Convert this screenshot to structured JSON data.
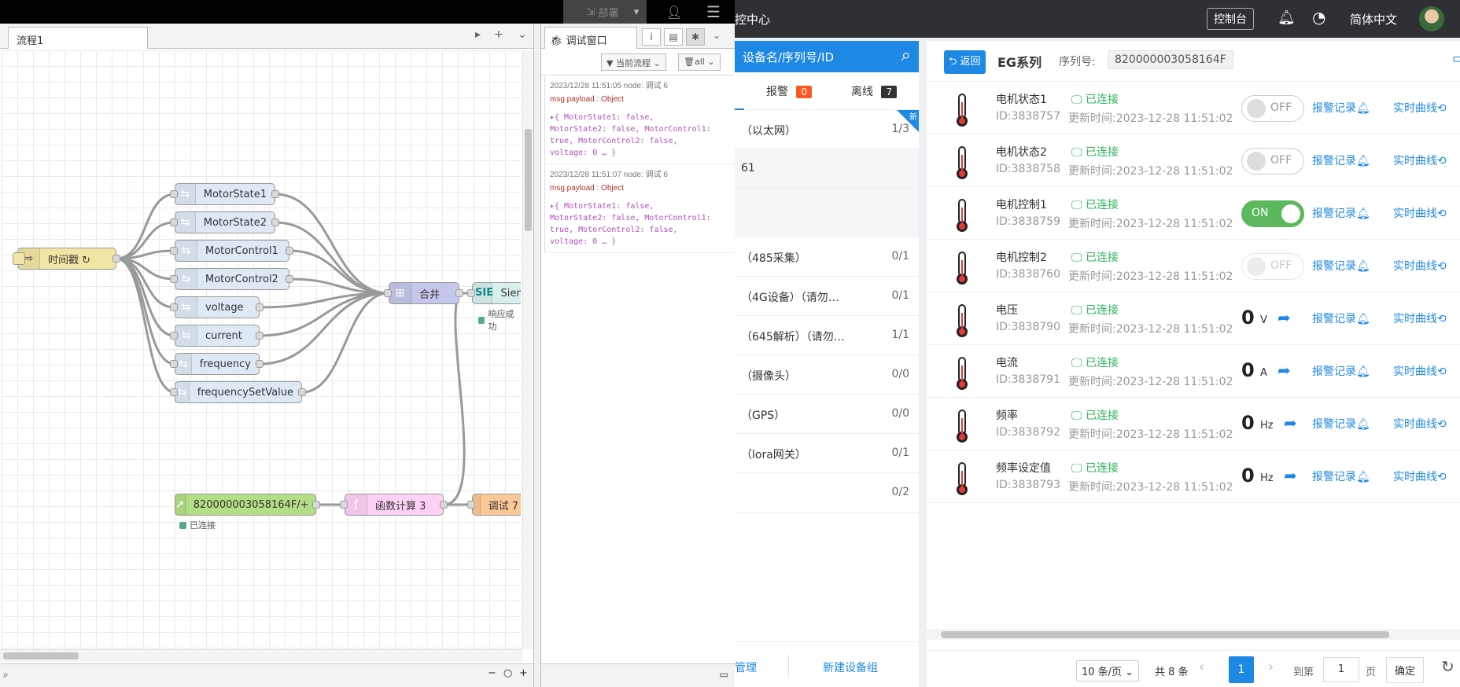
{
  "topbar": {
    "partial_title": "控中心",
    "console": "控制台",
    "language": "简体中文"
  },
  "device_list": {
    "search_placeholder": "设备名/序列号/ID",
    "tabs": [
      {
        "label": "报警",
        "count": "0",
        "color": "#ff5722"
      },
      {
        "label": "离线",
        "count": "7",
        "color": "#333"
      }
    ],
    "new_badge": "新",
    "groups": [
      {
        "name": "（以太网）",
        "count": "1/3"
      },
      {
        "name": "61",
        "count": ""
      },
      {
        "name": "",
        "count": ""
      },
      {
        "name": "（485采集）",
        "count": "0/1"
      },
      {
        "name": "（4G设备）（请勿…",
        "count": "0/1"
      },
      {
        "name": "（645解析）（请勿…",
        "count": "1/1"
      },
      {
        "name": "（摄像头）",
        "count": "0/0"
      },
      {
        "name": "（GPS）",
        "count": "0/0"
      },
      {
        "name": "（lora网关）",
        "count": "0/1"
      },
      {
        "name": "",
        "count": "0/2"
      }
    ],
    "footer_manage": "管理",
    "footer_new_group": "新建设备组"
  },
  "device_detail": {
    "back": "返回",
    "series": "EG系列",
    "serial_label": "序列号:",
    "serial": "820000003058164F",
    "alarm_link": "报警记录",
    "curve_link": "实时曲线",
    "rows": [
      {
        "name": "电机状态1",
        "id": "ID:3838757",
        "status": "已连接",
        "updated": "更新时间:2023-12-28 11:51:02",
        "control": "toggle",
        "state": "OFF"
      },
      {
        "name": "电机状态2",
        "id": "ID:3838758",
        "status": "已连接",
        "updated": "更新时间:2023-12-28 11:51:02",
        "control": "toggle",
        "state": "OFF"
      },
      {
        "name": "电机控制1",
        "id": "ID:3838759",
        "status": "已连接",
        "updated": "更新时间:2023-12-28 11:51:02",
        "control": "toggle",
        "state": "ON"
      },
      {
        "name": "电机控制2",
        "id": "ID:3838760",
        "status": "已连接",
        "updated": "更新时间:2023-12-28 11:51:02",
        "control": "toggle",
        "state": "OFF"
      },
      {
        "name": "电压",
        "id": "ID:3838790",
        "status": "已连接",
        "updated": "更新时间:2023-12-28 11:51:02",
        "control": "value",
        "value": "0",
        "unit": "V"
      },
      {
        "name": "电流",
        "id": "ID:3838791",
        "status": "已连接",
        "updated": "更新时间:2023-12-28 11:51:02",
        "control": "value",
        "value": "0",
        "unit": "A"
      },
      {
        "name": "频率",
        "id": "ID:3838792",
        "status": "已连接",
        "updated": "更新时间:2023-12-28 11:51:02",
        "control": "value",
        "value": "0",
        "unit": "Hz"
      },
      {
        "name": "频率设定值",
        "id": "ID:3838793",
        "status": "已连接",
        "updated": "更新时间:2023-12-28 11:51:02",
        "control": "value",
        "value": "0",
        "unit": "Hz"
      }
    ],
    "pager": {
      "page_size": "10 条/页",
      "total": "共 8 条",
      "current": "1",
      "goto": "到第",
      "goto_value": "1",
      "page_unit": "页",
      "confirm": "确定"
    }
  },
  "nodered": {
    "deploy": "部署",
    "flow_tab": "流程1",
    "debug_tab": "调试窗口",
    "filter_flow": "当前流程",
    "filter_all": "all",
    "messages": [
      {
        "meta": "2023/12/28 11:51:05   node: 调试 6",
        "type": "msg.payload : Object",
        "lines": [
          "▸{ MotorState1: false,",
          "MotorState2: false, MotorControl1:",
          "true, MotorControl2: false,",
          "voltage: 0 … }"
        ]
      },
      {
        "meta": "2023/12/28 11:51:07   node: 调试 6",
        "type": "msg.payload : Object",
        "lines": [
          "▸{ MotorState1: false,",
          "MotorState2: false, MotorControl1:",
          "true, MotorControl2: false,",
          "voltage: 0 … }"
        ]
      }
    ],
    "nodes": {
      "inject": "时间戳 ↻",
      "changes": [
        "MotorState1",
        "MotorState2",
        "MotorControl1",
        "MotorControl2",
        "voltage",
        "current",
        "frequency",
        "frequencySetValue"
      ],
      "join": "合并",
      "siemens": "Siem",
      "siemens_icon": "SIE",
      "siemens_status": "响应成功",
      "mqtt_in": "820000003058164F/+",
      "mqtt_status": "已连接",
      "func": "函数计算 3",
      "debug": "调试 7"
    },
    "colors": {
      "inject": "#f2e5a3",
      "change": "#dfe9f5",
      "join": "#c5c7ea",
      "func": "#fdd0f5",
      "mqtt": "#b4de86",
      "debug": "#f9c895",
      "siemens": "#d7f0ee"
    }
  }
}
